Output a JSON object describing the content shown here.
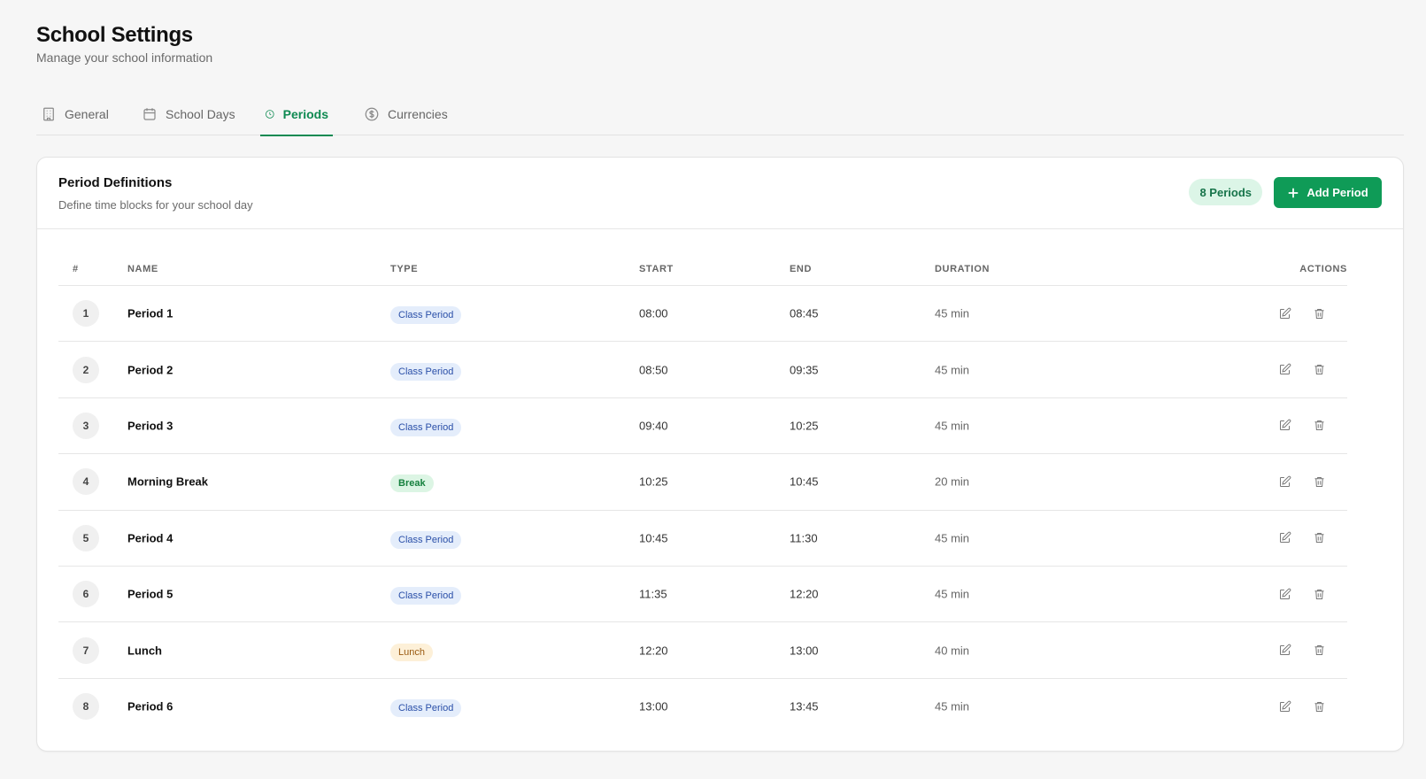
{
  "header": {
    "title": "School Settings",
    "subtitle": "Manage your school information"
  },
  "tabs": [
    {
      "label": "General",
      "icon": "building-icon",
      "active": false
    },
    {
      "label": "School Days",
      "icon": "calendar-icon",
      "active": false
    },
    {
      "label": "Periods",
      "icon": "clock-icon",
      "active": true
    },
    {
      "label": "Currencies",
      "icon": "dollar-circle-icon",
      "active": false
    }
  ],
  "card": {
    "title": "Period Definitions",
    "subtitle": "Define time blocks for your school day",
    "count_badge": "8 Periods",
    "add_button_label": "Add Period"
  },
  "columns": {
    "num": "#",
    "name": "NAME",
    "type": "TYPE",
    "start": "START",
    "end": "END",
    "duration": "DURATION",
    "actions": "ACTIONS"
  },
  "rows": [
    {
      "num": "1",
      "name": "Period 1",
      "type": "Class Period",
      "type_kind": "class",
      "start": "08:00",
      "end": "08:45",
      "duration": "45 min"
    },
    {
      "num": "2",
      "name": "Period 2",
      "type": "Class Period",
      "type_kind": "class",
      "start": "08:50",
      "end": "09:35",
      "duration": "45 min"
    },
    {
      "num": "3",
      "name": "Period 3",
      "type": "Class Period",
      "type_kind": "class",
      "start": "09:40",
      "end": "10:25",
      "duration": "45 min"
    },
    {
      "num": "4",
      "name": "Morning Break",
      "type": "Break",
      "type_kind": "break",
      "start": "10:25",
      "end": "10:45",
      "duration": "20 min"
    },
    {
      "num": "5",
      "name": "Period 4",
      "type": "Class Period",
      "type_kind": "class",
      "start": "10:45",
      "end": "11:30",
      "duration": "45 min"
    },
    {
      "num": "6",
      "name": "Period 5",
      "type": "Class Period",
      "type_kind": "class",
      "start": "11:35",
      "end": "12:20",
      "duration": "45 min"
    },
    {
      "num": "7",
      "name": "Lunch",
      "type": "Lunch",
      "type_kind": "lunch",
      "start": "12:20",
      "end": "13:00",
      "duration": "40 min"
    },
    {
      "num": "8",
      "name": "Period 6",
      "type": "Class Period",
      "type_kind": "class",
      "start": "13:00",
      "end": "13:45",
      "duration": "45 min"
    }
  ],
  "colors": {
    "accent": "#0f9b57",
    "accent_text": "#0f8a52",
    "class_badge_bg": "#e4edfb",
    "break_badge_bg": "#dcf5e4",
    "lunch_badge_bg": "#fdf0d8"
  }
}
